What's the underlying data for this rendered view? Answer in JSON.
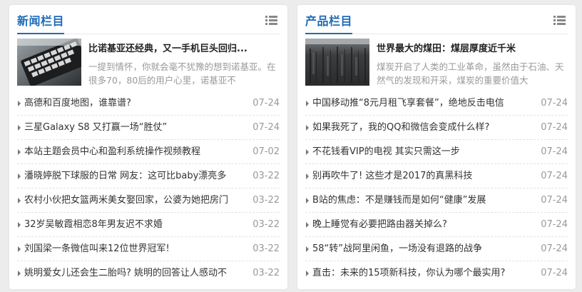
{
  "panels": [
    {
      "title": "新闻栏目",
      "icon": "list-icon",
      "feature": {
        "title": "比诺基亚还经典，又一手机巨头回归...",
        "desc": "一提到情怀，你就会毫不犹豫的想到诺基亚。在很多70，80后的用户心里，诺基亚不"
      },
      "items": [
        {
          "title": "高德和百度地图，谁靠谱?",
          "date": "07-24"
        },
        {
          "title": "三星Galaxy S8 又打赢一场“胜仗”",
          "date": "07-24"
        },
        {
          "title": "本站主题会员中心和盈利系统操作视频教程",
          "date": "07-02"
        },
        {
          "title": "潘晓婷脱下球服的日常 网友：这可比baby漂亮多",
          "date": "03-22"
        },
        {
          "title": "农村小伙把女篮两米美女娶回家，公婆为她把房门",
          "date": "03-22"
        },
        {
          "title": "32岁吴敏霞相恋8年男友迟不求婚",
          "date": "03-22"
        },
        {
          "title": "刘国梁一条微信叫来12位世界冠军!",
          "date": "03-22"
        },
        {
          "title": "姚明爱女儿还会生二胎吗? 姚明的回答让人感动不",
          "date": "03-22"
        }
      ]
    },
    {
      "title": "产品栏目",
      "icon": "list-icon",
      "feature": {
        "title": "世界最大的煤田：煤层厚度近千米",
        "desc": "煤炭开启了人类的工业革命，虽然由于石油、天然气的发现和开采，煤炭的重要价值大"
      },
      "items": [
        {
          "title": "中国移动推“8元月租飞享套餐”，绝地反击电信",
          "date": "07-24"
        },
        {
          "title": "如果我死了，我的QQ和微信会变成什么样?",
          "date": "07-24"
        },
        {
          "title": "不花钱看VIP的电视 其实只需这一步",
          "date": "07-24"
        },
        {
          "title": "别再吹牛了! 这些才是2017的真黑科技",
          "date": "07-24"
        },
        {
          "title": "B站的焦虑：不是赚钱而是如何“健康”发展",
          "date": "07-24"
        },
        {
          "title": "晚上睡觉有必要把路由器关掉么?",
          "date": "07-24"
        },
        {
          "title": "58“转”战阿里闲鱼，一场没有退路的战争",
          "date": "07-24"
        },
        {
          "title": "直击：未来的15项新科技，你认为哪个最实用?",
          "date": "07-24"
        }
      ]
    }
  ],
  "colors": {
    "accent": "#1e6bb8",
    "background": "#ececec",
    "date": "#999999"
  }
}
